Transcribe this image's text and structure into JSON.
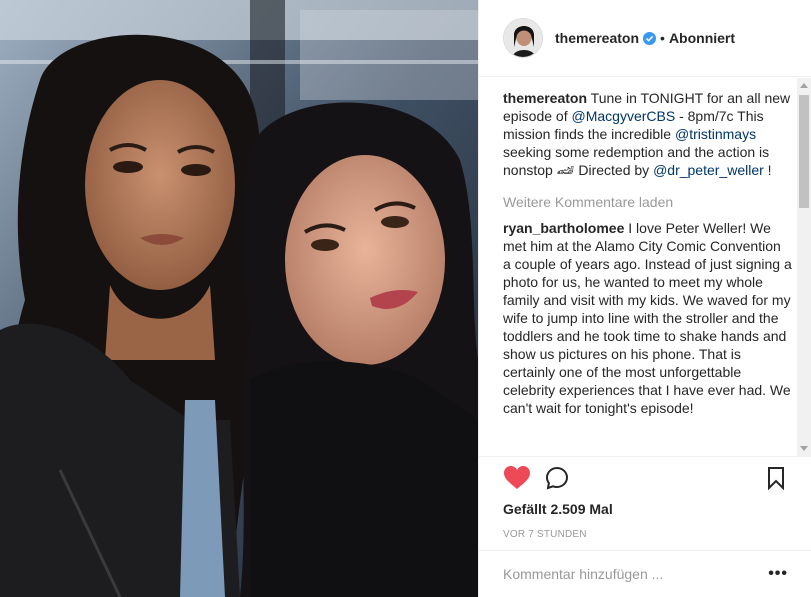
{
  "post": {
    "author": "themereaton",
    "follow_state": "Abonniert",
    "separator": "•",
    "caption": {
      "user": "themereaton",
      "text_parts": [
        "Tune in TONIGHT for an all new episode of ",
        "@MacgyverCBS",
        " - 8pm/7c This mission finds the incredible ",
        "@tristinmays",
        " seeking some redemption and the action is nonstop 🏎 Directed by ",
        "@dr_peter_weller",
        " !"
      ]
    },
    "load_more_label": "Weitere Kommentare laden",
    "comments": [
      {
        "user": "ryan_bartholomee",
        "text": "I love Peter Weller! We met him at the Alamo City Comic Convention a couple of years ago. Instead of just signing a photo for us, he wanted to meet my whole family and visit with my kids. We waved for my wife to jump into line with the stroller and the toddlers and he took time to shake hands and show us pictures on his phone. That is certainly one of the most unforgettable celebrity experiences that I have ever had. We can't wait for tonight's episode!"
      }
    ],
    "likes_label": "Gefällt 2.509 Mal",
    "timestamp": "VOR 7 STUNDEN",
    "add_comment_placeholder": "Kommentar hinzufügen ...",
    "more_label": "•••"
  },
  "icons": {
    "like": "heart-icon",
    "comment": "comment-bubble-icon",
    "save": "bookmark-icon",
    "verified": "verified-badge-icon",
    "more": "more-options-icon"
  },
  "colors": {
    "like_red": "#ed4956",
    "link_blue": "#003569",
    "verified_blue": "#3897f0",
    "muted_gray": "#999999",
    "text": "#262626"
  }
}
